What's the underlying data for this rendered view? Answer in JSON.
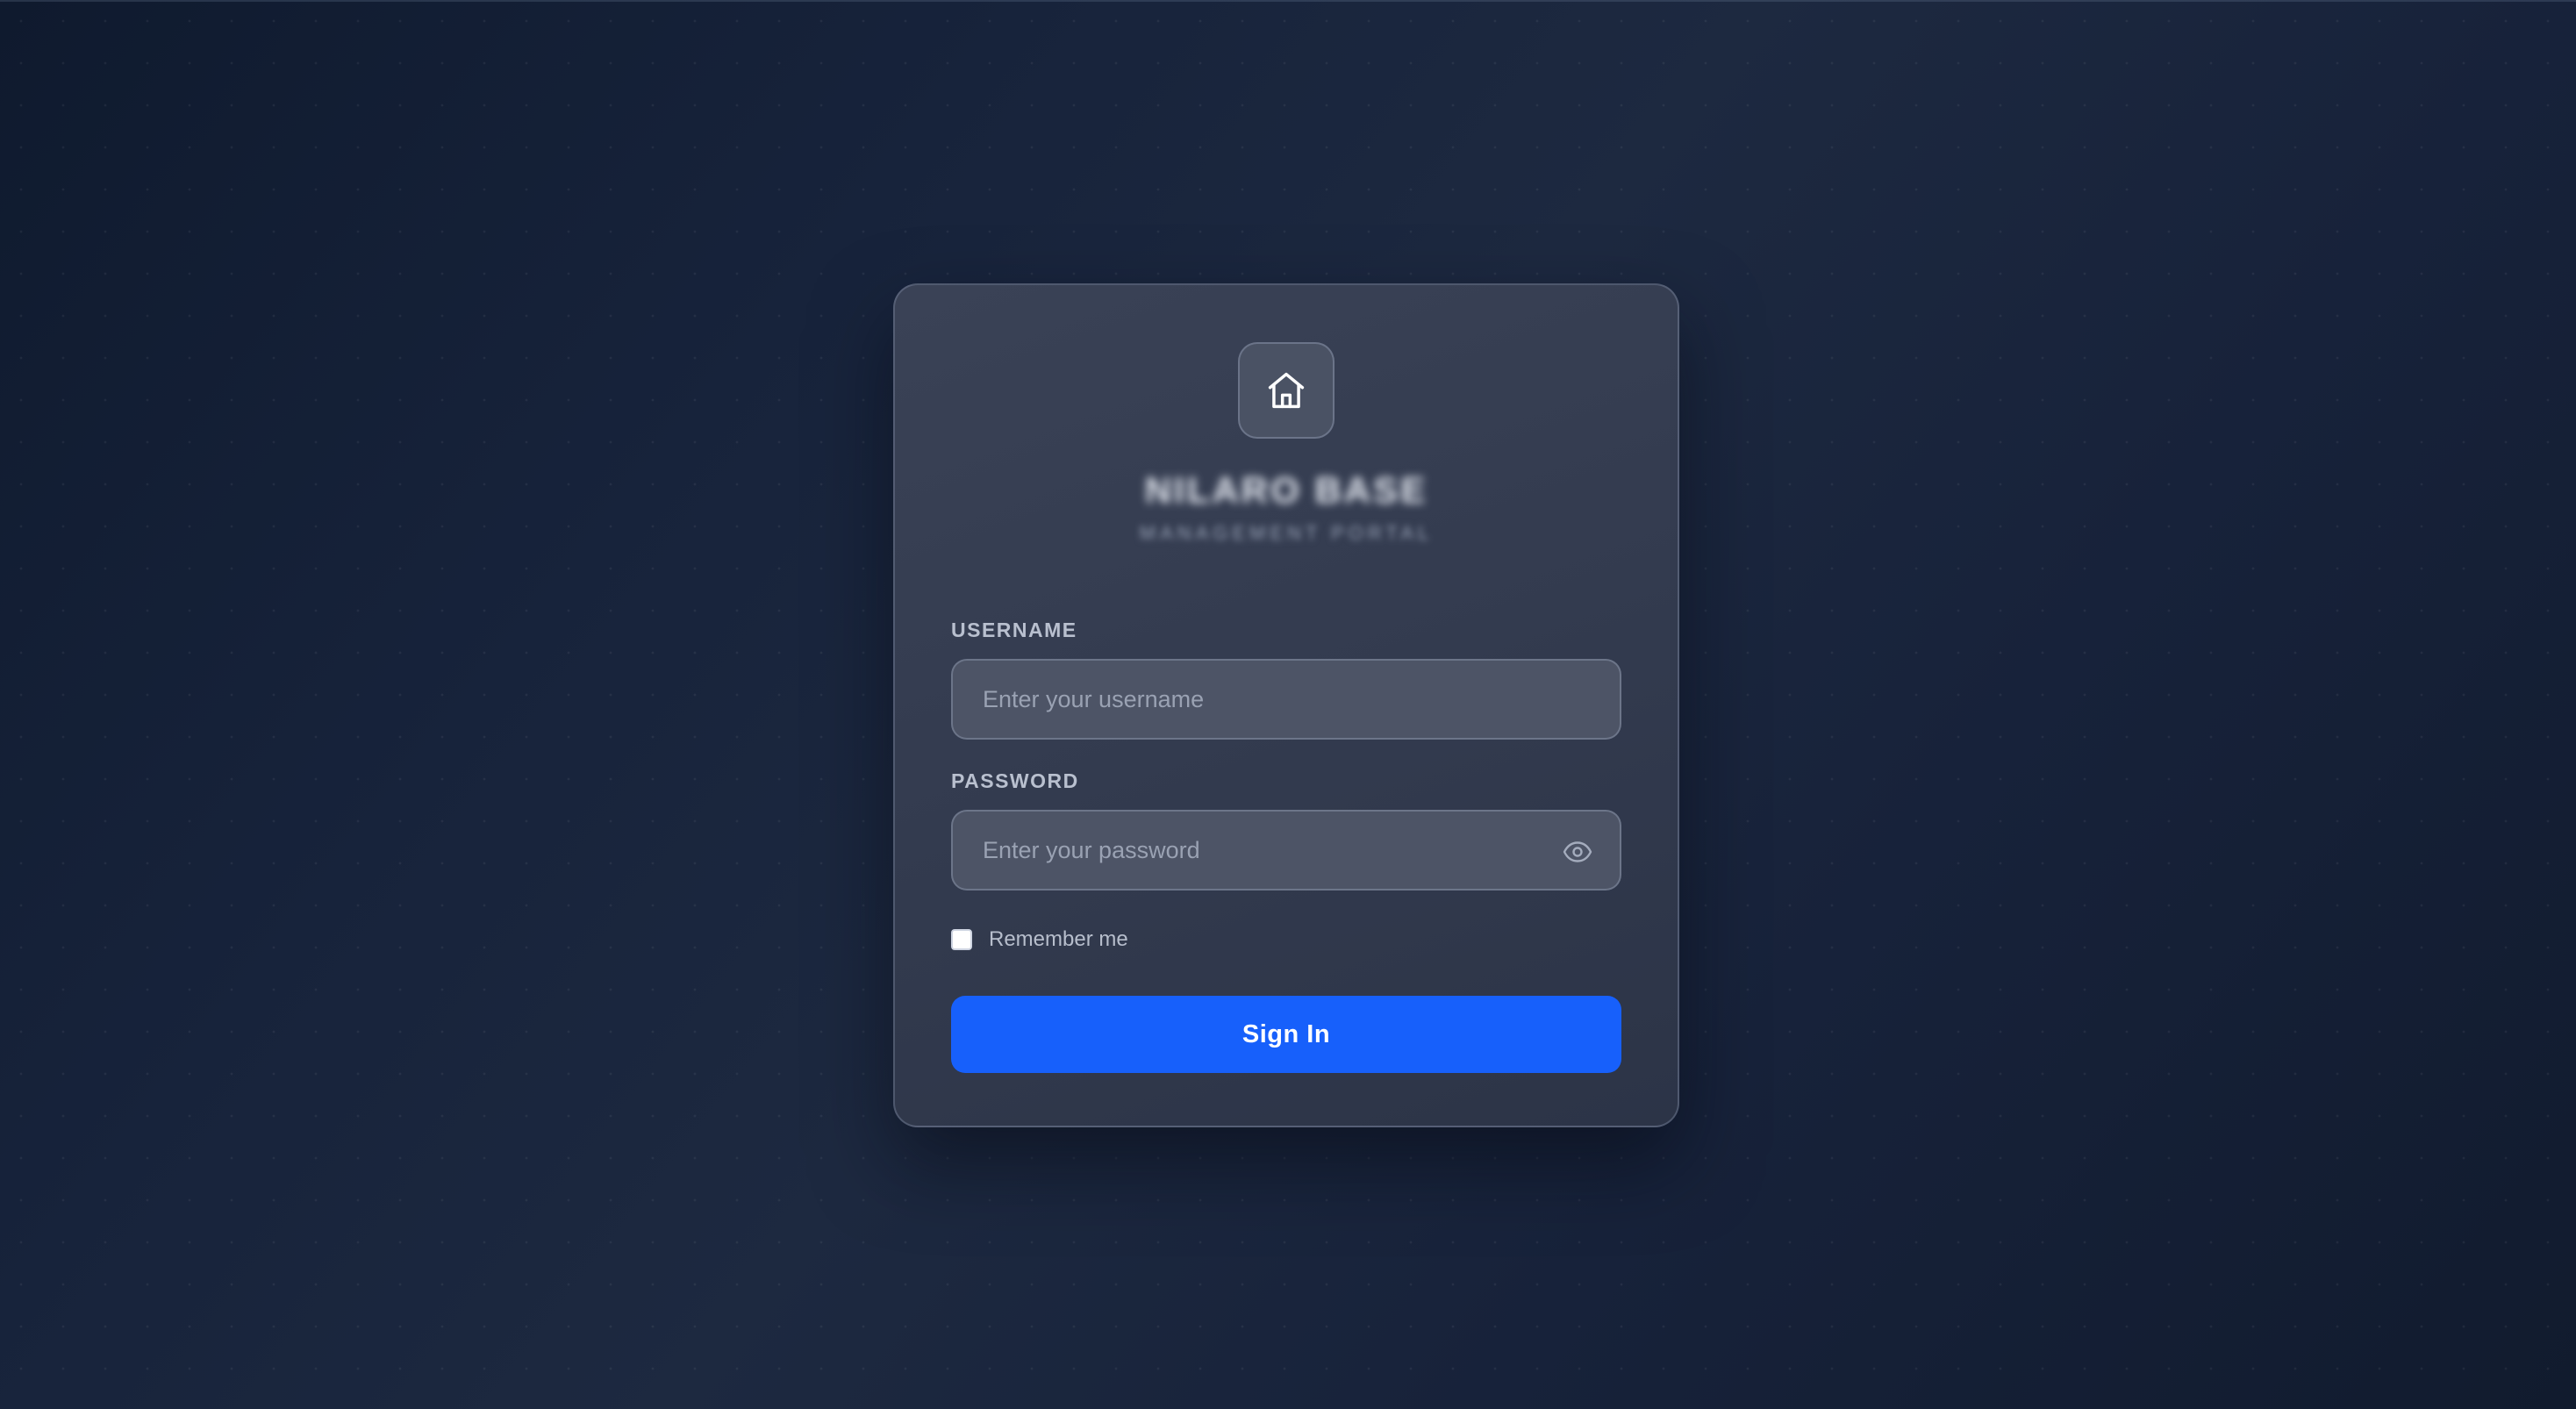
{
  "brand": {
    "title": "NILARO BASE",
    "subtitle": "MANAGEMENT PORTAL",
    "logo_icon": "home-icon"
  },
  "form": {
    "username": {
      "label": "USERNAME",
      "placeholder": "Enter your username",
      "value": ""
    },
    "password": {
      "label": "PASSWORD",
      "placeholder": "Enter your password",
      "value": "",
      "toggle_icon": "eye-icon"
    },
    "remember": {
      "label": "Remember me",
      "checked": false
    },
    "submit_label": "Sign In"
  },
  "colors": {
    "accent": "#1760fb",
    "background": "#17233b",
    "card": "#363e52"
  }
}
